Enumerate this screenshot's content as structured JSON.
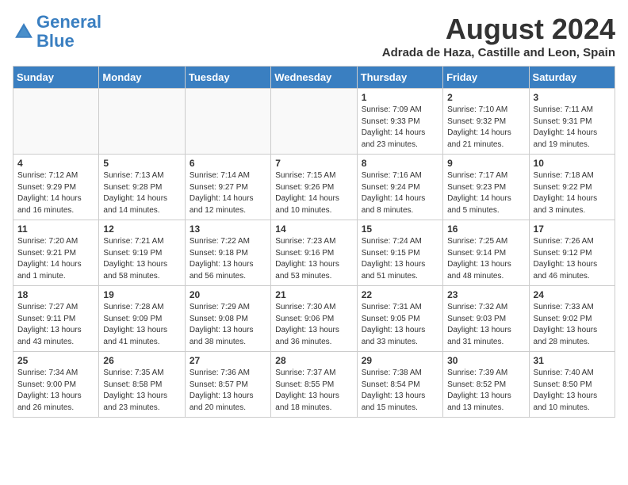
{
  "header": {
    "logo_line1": "General",
    "logo_line2": "Blue",
    "month_title": "August 2024",
    "location": "Adrada de Haza, Castille and Leon, Spain"
  },
  "days_of_week": [
    "Sunday",
    "Monday",
    "Tuesday",
    "Wednesday",
    "Thursday",
    "Friday",
    "Saturday"
  ],
  "weeks": [
    [
      {
        "day": "",
        "info": ""
      },
      {
        "day": "",
        "info": ""
      },
      {
        "day": "",
        "info": ""
      },
      {
        "day": "",
        "info": ""
      },
      {
        "day": "1",
        "info": "Sunrise: 7:09 AM\nSunset: 9:33 PM\nDaylight: 14 hours\nand 23 minutes."
      },
      {
        "day": "2",
        "info": "Sunrise: 7:10 AM\nSunset: 9:32 PM\nDaylight: 14 hours\nand 21 minutes."
      },
      {
        "day": "3",
        "info": "Sunrise: 7:11 AM\nSunset: 9:31 PM\nDaylight: 14 hours\nand 19 minutes."
      }
    ],
    [
      {
        "day": "4",
        "info": "Sunrise: 7:12 AM\nSunset: 9:29 PM\nDaylight: 14 hours\nand 16 minutes."
      },
      {
        "day": "5",
        "info": "Sunrise: 7:13 AM\nSunset: 9:28 PM\nDaylight: 14 hours\nand 14 minutes."
      },
      {
        "day": "6",
        "info": "Sunrise: 7:14 AM\nSunset: 9:27 PM\nDaylight: 14 hours\nand 12 minutes."
      },
      {
        "day": "7",
        "info": "Sunrise: 7:15 AM\nSunset: 9:26 PM\nDaylight: 14 hours\nand 10 minutes."
      },
      {
        "day": "8",
        "info": "Sunrise: 7:16 AM\nSunset: 9:24 PM\nDaylight: 14 hours\nand 8 minutes."
      },
      {
        "day": "9",
        "info": "Sunrise: 7:17 AM\nSunset: 9:23 PM\nDaylight: 14 hours\nand 5 minutes."
      },
      {
        "day": "10",
        "info": "Sunrise: 7:18 AM\nSunset: 9:22 PM\nDaylight: 14 hours\nand 3 minutes."
      }
    ],
    [
      {
        "day": "11",
        "info": "Sunrise: 7:20 AM\nSunset: 9:21 PM\nDaylight: 14 hours\nand 1 minute."
      },
      {
        "day": "12",
        "info": "Sunrise: 7:21 AM\nSunset: 9:19 PM\nDaylight: 13 hours\nand 58 minutes."
      },
      {
        "day": "13",
        "info": "Sunrise: 7:22 AM\nSunset: 9:18 PM\nDaylight: 13 hours\nand 56 minutes."
      },
      {
        "day": "14",
        "info": "Sunrise: 7:23 AM\nSunset: 9:16 PM\nDaylight: 13 hours\nand 53 minutes."
      },
      {
        "day": "15",
        "info": "Sunrise: 7:24 AM\nSunset: 9:15 PM\nDaylight: 13 hours\nand 51 minutes."
      },
      {
        "day": "16",
        "info": "Sunrise: 7:25 AM\nSunset: 9:14 PM\nDaylight: 13 hours\nand 48 minutes."
      },
      {
        "day": "17",
        "info": "Sunrise: 7:26 AM\nSunset: 9:12 PM\nDaylight: 13 hours\nand 46 minutes."
      }
    ],
    [
      {
        "day": "18",
        "info": "Sunrise: 7:27 AM\nSunset: 9:11 PM\nDaylight: 13 hours\nand 43 minutes."
      },
      {
        "day": "19",
        "info": "Sunrise: 7:28 AM\nSunset: 9:09 PM\nDaylight: 13 hours\nand 41 minutes."
      },
      {
        "day": "20",
        "info": "Sunrise: 7:29 AM\nSunset: 9:08 PM\nDaylight: 13 hours\nand 38 minutes."
      },
      {
        "day": "21",
        "info": "Sunrise: 7:30 AM\nSunset: 9:06 PM\nDaylight: 13 hours\nand 36 minutes."
      },
      {
        "day": "22",
        "info": "Sunrise: 7:31 AM\nSunset: 9:05 PM\nDaylight: 13 hours\nand 33 minutes."
      },
      {
        "day": "23",
        "info": "Sunrise: 7:32 AM\nSunset: 9:03 PM\nDaylight: 13 hours\nand 31 minutes."
      },
      {
        "day": "24",
        "info": "Sunrise: 7:33 AM\nSunset: 9:02 PM\nDaylight: 13 hours\nand 28 minutes."
      }
    ],
    [
      {
        "day": "25",
        "info": "Sunrise: 7:34 AM\nSunset: 9:00 PM\nDaylight: 13 hours\nand 26 minutes."
      },
      {
        "day": "26",
        "info": "Sunrise: 7:35 AM\nSunset: 8:58 PM\nDaylight: 13 hours\nand 23 minutes."
      },
      {
        "day": "27",
        "info": "Sunrise: 7:36 AM\nSunset: 8:57 PM\nDaylight: 13 hours\nand 20 minutes."
      },
      {
        "day": "28",
        "info": "Sunrise: 7:37 AM\nSunset: 8:55 PM\nDaylight: 13 hours\nand 18 minutes."
      },
      {
        "day": "29",
        "info": "Sunrise: 7:38 AM\nSunset: 8:54 PM\nDaylight: 13 hours\nand 15 minutes."
      },
      {
        "day": "30",
        "info": "Sunrise: 7:39 AM\nSunset: 8:52 PM\nDaylight: 13 hours\nand 13 minutes."
      },
      {
        "day": "31",
        "info": "Sunrise: 7:40 AM\nSunset: 8:50 PM\nDaylight: 13 hours\nand 10 minutes."
      }
    ]
  ]
}
